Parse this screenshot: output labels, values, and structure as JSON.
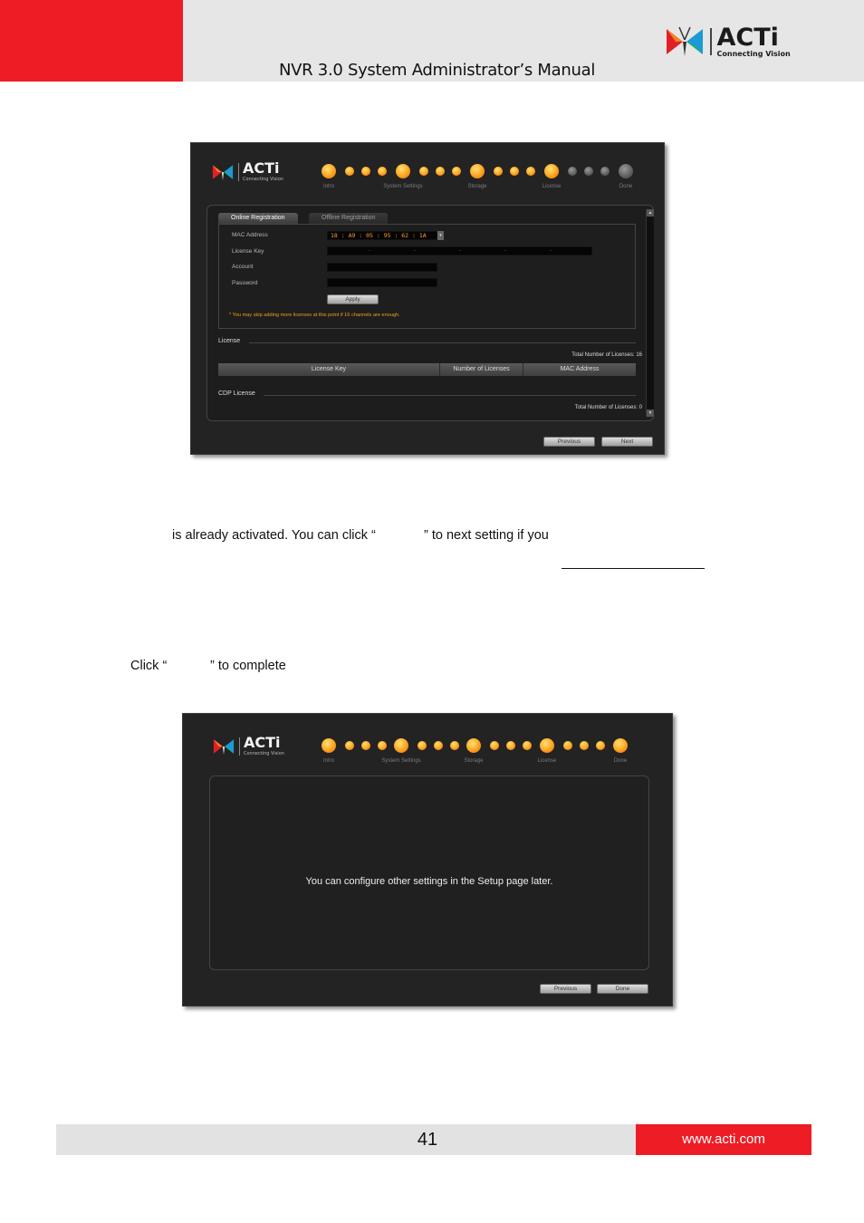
{
  "header": {
    "title": "NVR 3.0 System Administrator’s Manual",
    "logo_text": "ACTi",
    "logo_tagline": "Connecting Vision"
  },
  "screenshot1": {
    "logo_text": "ACTi",
    "logo_tagline": "Connecting Vision",
    "steps": [
      "Intro",
      "System Settings",
      "Storage",
      "License",
      "Done"
    ],
    "tabs": {
      "online": "Online Registration",
      "offline": "Offline Registration"
    },
    "form": {
      "mac_label": "MAC Address",
      "mac_value": "18 : A9 : 05 : 95 : 62 : 1A",
      "license_key_label": "License Key",
      "license_key_separator": "-",
      "account_label": "Account",
      "password_label": "Password",
      "apply_button": "Apply",
      "note": "* You may skip adding more licenses at this point if 16 channels are enough."
    },
    "license_section": {
      "title": "License",
      "total": "Total Number of Licenses: 16",
      "columns": [
        "License Key",
        "Number of Licenses",
        "MAC Address"
      ]
    },
    "cdp_section": {
      "title": "CDP License",
      "total": "Total Number of Licenses: 0"
    },
    "buttons": {
      "previous": "Previous",
      "next": "Next"
    }
  },
  "body": {
    "line1_part1": "is already activated. You can click “",
    "line1_part2": "” to next setting if you",
    "line2_part1": "Click “",
    "line2_part2": "” to complete"
  },
  "screenshot2": {
    "logo_text": "ACTi",
    "logo_tagline": "Connecting Vision",
    "steps": [
      "Intro",
      "System Settings",
      "Storage",
      "License",
      "Done"
    ],
    "message": "You can configure other settings in the Setup page later.",
    "buttons": {
      "previous": "Previous",
      "done": "Done"
    }
  },
  "footer": {
    "page_number": "41",
    "website": "www.acti.com"
  },
  "colors": {
    "brand_red": "#ee1c25",
    "header_gray": "#e6e6e6",
    "step_active": "#ffae2a",
    "note_orange": "#f0a018"
  }
}
